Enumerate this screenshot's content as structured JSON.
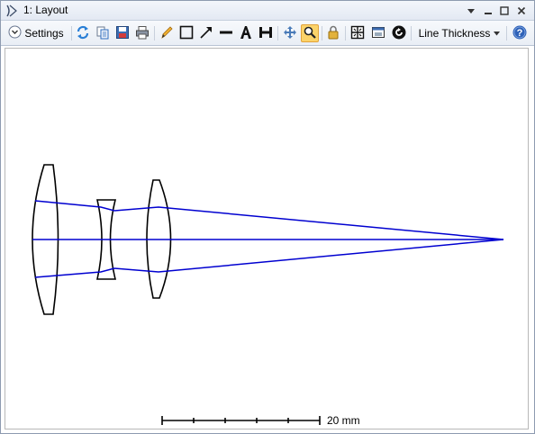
{
  "window": {
    "title": "1: Layout"
  },
  "toolbar": {
    "settings_label": "Settings",
    "line_thickness_label": "Line Thickness",
    "icons": [
      "refresh-icon",
      "copy-icon",
      "save-icon",
      "print-icon",
      "pencil-icon",
      "rectangle-icon",
      "arrow-icon",
      "line-icon",
      "text-icon",
      "dimension-icon",
      "pan-icon",
      "zoom-icon",
      "lock-icon",
      "fit-icon",
      "window-icon",
      "rotate-icon",
      "help-icon"
    ],
    "active_tool": "zoom-icon"
  },
  "layout": {
    "scale_label": "20 mm",
    "ray_color": "#0000d0",
    "lens_color": "#000000"
  }
}
